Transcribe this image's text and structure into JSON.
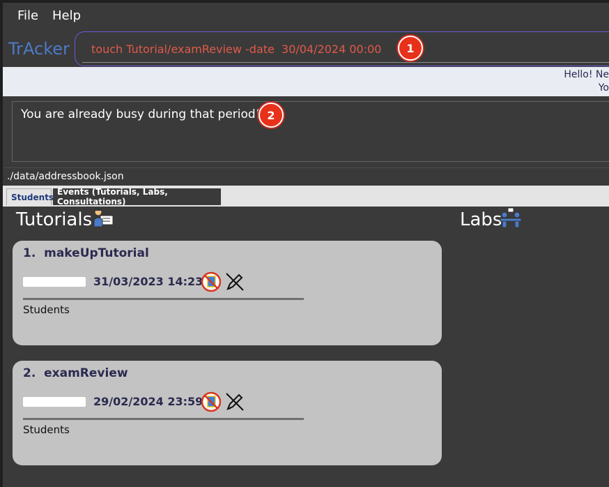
{
  "menu": {
    "file": "File",
    "help": "Help"
  },
  "app": {
    "title": "TrAcker"
  },
  "command": {
    "value": "touch Tutorial/examReview -date  30/04/2024 00:00"
  },
  "badges": {
    "one": "1",
    "two": "2"
  },
  "hello": {
    "line1": "Hello! Ne",
    "line2": "Yo"
  },
  "result": {
    "message": "You are already busy during that period!"
  },
  "status": {
    "path": "./data/addressbook.json"
  },
  "tabs": [
    {
      "label": "Students"
    },
    {
      "label": "Events (Tutorials, Labs, Consultations)"
    }
  ],
  "sections": {
    "tutorials": {
      "title": "Tutorials"
    },
    "labs": {
      "title": "Labs"
    }
  },
  "tutorials": [
    {
      "title": "1.  makeUpTutorial",
      "date": "31/03/2023 14:23",
      "students_label": "Students"
    },
    {
      "title": "2.  examReview",
      "date": "29/02/2024 23:59",
      "students_label": "Students"
    }
  ],
  "colors": {
    "accent": "#4d7ac6",
    "command_text": "#e05a4a",
    "badge": "#e8311a",
    "card": "#c3c3c3"
  },
  "icons": [
    "person-at-board-icon",
    "people-at-desk-icon",
    "no-document-icon",
    "pen-crossed-icon"
  ]
}
